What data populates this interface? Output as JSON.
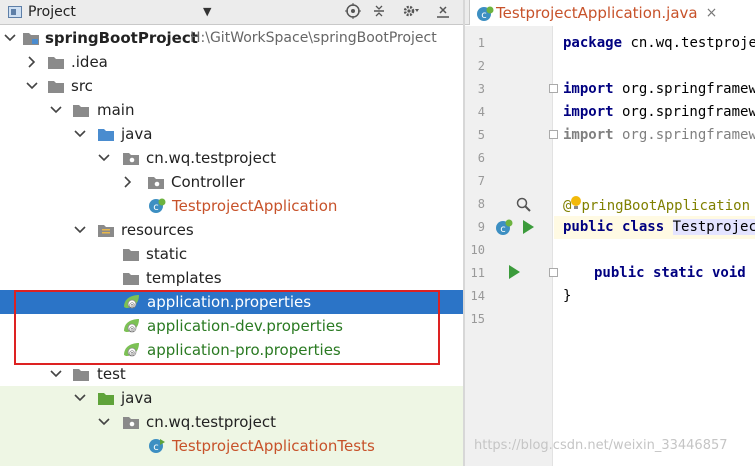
{
  "project_pane": {
    "title": "Project",
    "dropdown_glyph": "▼",
    "tools": [
      "target-icon",
      "collapse-icon",
      "gear-icon",
      "hide-icon"
    ]
  },
  "tree": [
    {
      "label": "springBootProject",
      "path": "H:\\GitWorkSpace\\springBootProject",
      "icon": "module-folder-icon",
      "expanded": true
    },
    {
      "label": ".idea",
      "icon": "folder-icon",
      "expanded": false
    },
    {
      "label": "src",
      "icon": "folder-icon",
      "expanded": true
    },
    {
      "label": "main",
      "icon": "folder-icon",
      "expanded": true
    },
    {
      "label": "java",
      "icon": "source-folder-icon",
      "expanded": true
    },
    {
      "label": "cn.wq.testproject",
      "icon": "package-icon",
      "expanded": true
    },
    {
      "label": "Controller",
      "icon": "package-icon",
      "expanded": false
    },
    {
      "label": "TestprojectApplication",
      "icon": "spring-class-icon"
    },
    {
      "label": "resources",
      "icon": "resources-folder-icon",
      "expanded": true
    },
    {
      "label": "static",
      "icon": "folder-icon"
    },
    {
      "label": "templates",
      "icon": "folder-icon"
    },
    {
      "label": "application.properties",
      "icon": "spring-properties-icon",
      "selected": true
    },
    {
      "label": "application-dev.properties",
      "icon": "spring-properties-icon"
    },
    {
      "label": "application-pro.properties",
      "icon": "spring-properties-icon"
    },
    {
      "label": "test",
      "icon": "folder-icon",
      "expanded": true
    },
    {
      "label": "java",
      "icon": "test-folder-icon",
      "expanded": true
    },
    {
      "label": "cn.wq.testproject",
      "icon": "package-icon",
      "expanded": true
    },
    {
      "label": "TestprojectApplicationTests",
      "icon": "test-class-icon"
    }
  ],
  "editor": {
    "tab_label": "TestprojectApplication.java",
    "tab_close": "×",
    "line_numbers": [
      "1",
      "2",
      "3",
      "4",
      "5",
      "6",
      "7",
      "8",
      "9",
      "10",
      "11",
      "14",
      "15"
    ],
    "code": {
      "l1_kw": "package",
      "l1_rest": " cn.wq.testproje",
      "l3_kw": "import",
      "l3_rest": " org.springframew",
      "l4_kw": "import",
      "l4_rest": " org.springframew",
      "l5_kw": "import",
      "l5_rest": " org.springframew",
      "l8_ann_pre": "@",
      "l8_ann_post": "pringBootApplication",
      "l9_kw": "public class",
      "l9_cls": "Testprojec",
      "l11_kw": "public static void",
      "l14": "}"
    }
  },
  "watermark": "https://blog.csdn.net/weixin_33446857",
  "colors": {
    "selection": "#2b74c7",
    "highlight_box": "#dd2222",
    "keyword": "#000080",
    "spring_green": "#6db33f"
  }
}
